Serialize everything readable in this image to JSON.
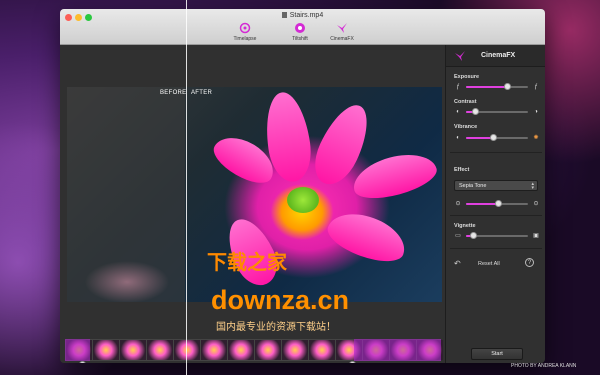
{
  "window": {
    "title": "Stairs.mp4"
  },
  "toolbar": {
    "tools": [
      {
        "label": "Timelapse",
        "icon": "timelapse-icon"
      },
      {
        "label": "Tiltshift",
        "icon": "tiltshift-icon"
      },
      {
        "label": "CinemaFX",
        "icon": "cinemafx-icon"
      }
    ]
  },
  "preview": {
    "before_label": "BEFORE",
    "after_label": "AFTER"
  },
  "panel": {
    "title": "CinemaFX",
    "exposure_label": "Exposure",
    "exposure_value": 0.66,
    "contrast_label": "Contrast",
    "contrast_value": 0.14,
    "vibrance_label": "Vibrance",
    "vibrance_value": 0.44,
    "effect_label": "Effect",
    "effect_selected": "Sepia Tone",
    "effect_amount": 0.52,
    "vignette_label": "Vignette",
    "vignette_value": 0.12,
    "reset_label": "Reset All",
    "help_label": "?",
    "start_label": "Start"
  },
  "watermark": {
    "line1": "下载之家",
    "line2": "downza.cn",
    "line3": "国内最专业的资源下载站！"
  },
  "credit": "PHOTO BY ANDREA KLANN",
  "colors": {
    "accent": "#e040e0",
    "panel_bg": "#303030",
    "titlebar": "#dcdcdc"
  }
}
